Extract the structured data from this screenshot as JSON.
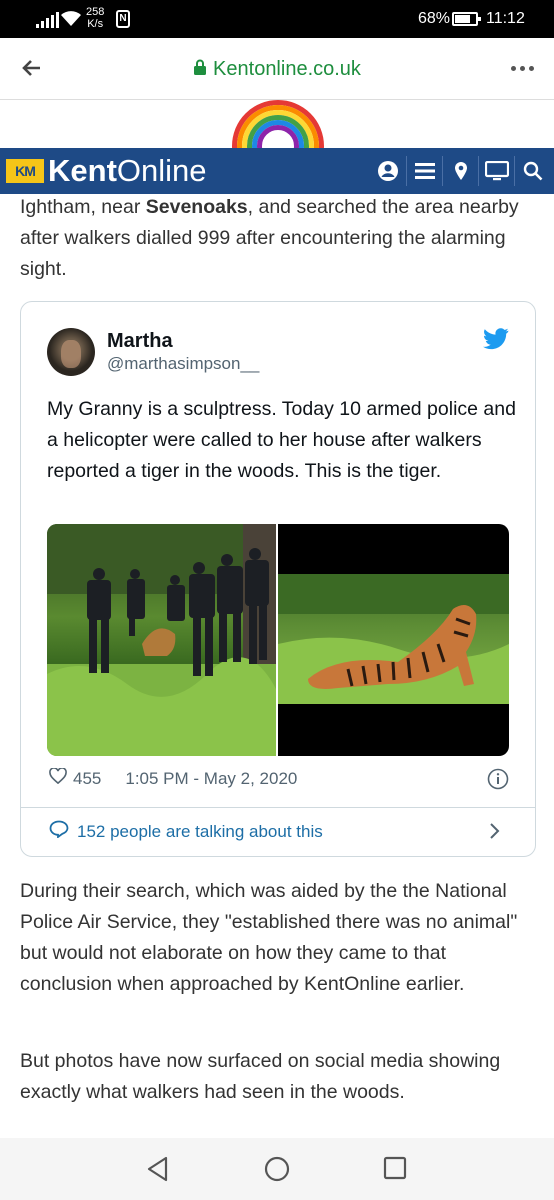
{
  "statusbar": {
    "speed_value": "258",
    "speed_unit": "K/s",
    "nfc": "N",
    "battery": "68%",
    "time": "11:12"
  },
  "browser": {
    "url": "Kentonline.co.uk"
  },
  "site": {
    "km_logo": "KM",
    "brand_bold": "Kent",
    "brand_light": "Online",
    "colors": {
      "header": "#1e4a86",
      "logo": "#f5c518"
    }
  },
  "article": {
    "para_top_pre": "Ightham, near ",
    "para_top_bold": "Sevenoaks",
    "para_top_post": ", and searched the area nearby after walkers dialled 999 after encountering the alarming sight.",
    "para_after1": "During their search, which was aided by the the National Police Air Service, they \"established there was no animal\" but would not elaborate on how they came to that conclusion when approached by KentOnline earlier.",
    "para_after2": "But photos have now surfaced on social media showing exactly what walkers had seen in the woods."
  },
  "tweet": {
    "name": "Martha",
    "handle": "@marthasimpson__",
    "text": "My Granny is a sculptress. Today 10 armed police and a helicopter were called to her house after walkers reported a tiger in the woods. This is the tiger.",
    "likes": "455",
    "timestamp": "1:05 PM - May 2, 2020",
    "talking": "152 people are talking about this"
  }
}
